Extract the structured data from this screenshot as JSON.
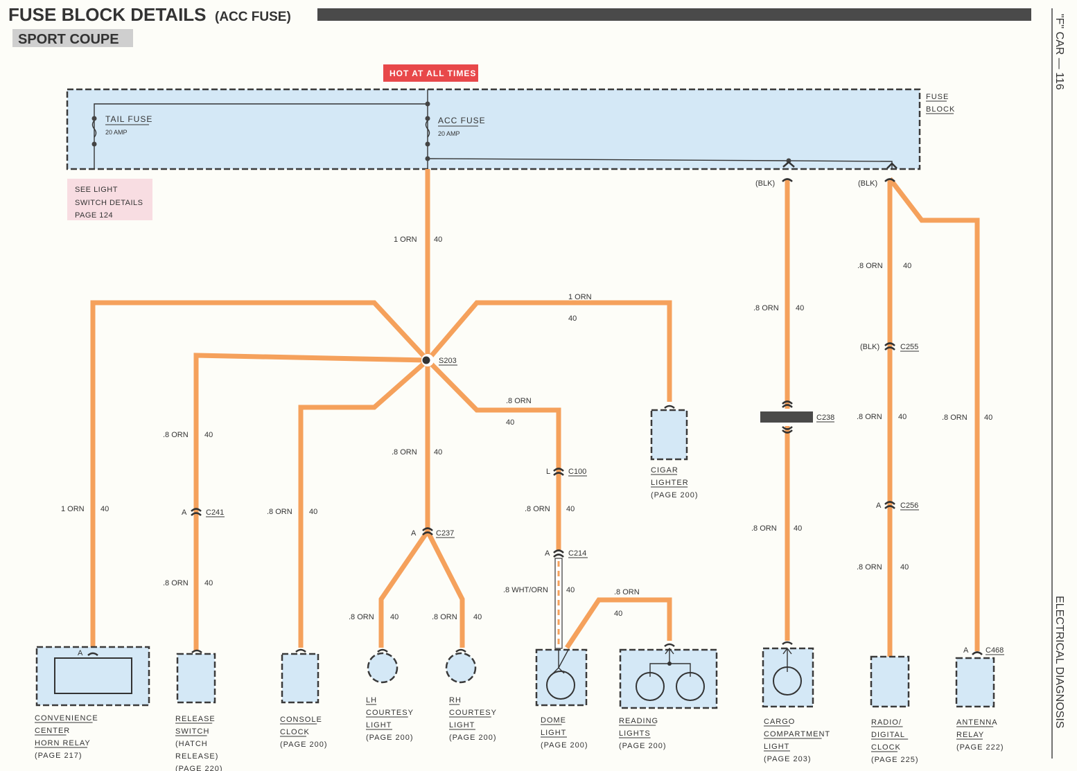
{
  "header": {
    "title": "FUSE BLOCK DETAILS",
    "subtitle": "(ACC FUSE)",
    "model": "SPORT COUPE",
    "side_top": "\"F\" CAR — 116",
    "side_bottom": "ELECTRICAL DIAGNOSIS"
  },
  "colors": {
    "wire": "#f5a15c",
    "hot_badge": "#e8484a",
    "fuse_block_fill": "#d4e8f6",
    "note_fill": "#f8dde2",
    "dark_bar": "#4a4a4a"
  },
  "hot_badge": "HOT AT ALL TIMES",
  "fuse_block": {
    "label_line1": "FUSE",
    "label_line2": "BLOCK",
    "fuses": [
      {
        "name": "TAIL FUSE",
        "rating": "20 AMP"
      },
      {
        "name": "ACC FUSE",
        "rating": "20 AMP"
      }
    ],
    "connector_color_left": "(BLK)",
    "connector_color_right": "(BLK)"
  },
  "note": {
    "line1": "SEE LIGHT",
    "line2": "SWITCH DETAILS",
    "line3": "PAGE 124"
  },
  "splice": "S203",
  "wires": {
    "main_feed": {
      "gauge": "1 ORN",
      "circuit": "40"
    },
    "horn_relay": {
      "gauge": "1 ORN",
      "circuit": "40"
    },
    "cigar_lighter": {
      "gauge": "1 ORN",
      "circuit": "40"
    },
    "release_upper": {
      "gauge": ".8 ORN",
      "circuit": "40"
    },
    "release_lower": {
      "gauge": ".8 ORN",
      "circuit": "40"
    },
    "console_clock": {
      "gauge": ".8 ORN",
      "circuit": "40"
    },
    "courtesy_trunk": {
      "gauge": ".8 ORN",
      "circuit": "40"
    },
    "lh_courtesy": {
      "gauge": ".8 ORN",
      "circuit": "40"
    },
    "rh_courtesy": {
      "gauge": ".8 ORN",
      "circuit": "40"
    },
    "dome_upper": {
      "gauge": ".8 ORN",
      "circuit": "40"
    },
    "dome_mid": {
      "gauge": ".8 ORN",
      "circuit": "40"
    },
    "dome_lower": {
      "gauge": ".8 WHT/ORN",
      "circuit": "40"
    },
    "reading": {
      "gauge": ".8 ORN",
      "circuit": "40"
    },
    "cargo_upper": {
      "gauge": ".8 ORN",
      "circuit": "40"
    },
    "cargo_lower": {
      "gauge": ".8 ORN",
      "circuit": "40"
    },
    "radio_upper": {
      "gauge": ".8 ORN",
      "circuit": "40"
    },
    "radio_mid": {
      "gauge": ".8 ORN",
      "circuit": "40"
    },
    "radio_lower": {
      "gauge": ".8 ORN",
      "circuit": "40"
    },
    "antenna": {
      "gauge": ".8 ORN",
      "circuit": "40"
    }
  },
  "connectors": {
    "c241": {
      "id": "C241",
      "pin": "A"
    },
    "c237": {
      "id": "C237",
      "pin": "A"
    },
    "c100": {
      "id": "C100",
      "pin": "L"
    },
    "c214": {
      "id": "C214",
      "pin": "A"
    },
    "c238": {
      "id": "C238"
    },
    "c255": {
      "id": "C255",
      "color": "(BLK)"
    },
    "c256": {
      "id": "C256",
      "pin": "A"
    },
    "c468": {
      "id": "C468",
      "pin": "A"
    },
    "horn_pin": "A"
  },
  "components": [
    {
      "key": "horn",
      "lines": [
        "CONVENIENCE",
        "CENTER",
        "HORN RELAY"
      ],
      "page": "(PAGE 217)"
    },
    {
      "key": "release",
      "lines": [
        "RELEASE",
        "SWITCH"
      ],
      "extra": [
        "(HATCH",
        "RELEASE)"
      ],
      "page": "(PAGE 220)"
    },
    {
      "key": "console",
      "lines": [
        "CONSOLE",
        "CLOCK"
      ],
      "page": "(PAGE 200)"
    },
    {
      "key": "lh",
      "lines": [
        "LH",
        "COURTESY",
        "LIGHT"
      ],
      "page": "(PAGE 200)"
    },
    {
      "key": "rh",
      "lines": [
        "RH",
        "COURTESY",
        "LIGHT"
      ],
      "page": "(PAGE 200)"
    },
    {
      "key": "dome",
      "lines": [
        "DOME",
        "LIGHT"
      ],
      "page": "(PAGE 200)"
    },
    {
      "key": "reading",
      "lines": [
        "READING",
        "LIGHTS"
      ],
      "page": "(PAGE 200)"
    },
    {
      "key": "cigar",
      "lines": [
        "CIGAR",
        "LIGHTER"
      ],
      "page": "(PAGE 200)"
    },
    {
      "key": "cargo",
      "lines": [
        "CARGO",
        "COMPARTMENT",
        "LIGHT"
      ],
      "page": "(PAGE 203)"
    },
    {
      "key": "radio",
      "lines": [
        "RADIO/",
        "DIGITAL",
        "CLOCK"
      ],
      "page": "(PAGE 225)"
    },
    {
      "key": "antenna",
      "lines": [
        "ANTENNA",
        "RELAY"
      ],
      "page": "(PAGE 222)"
    }
  ]
}
